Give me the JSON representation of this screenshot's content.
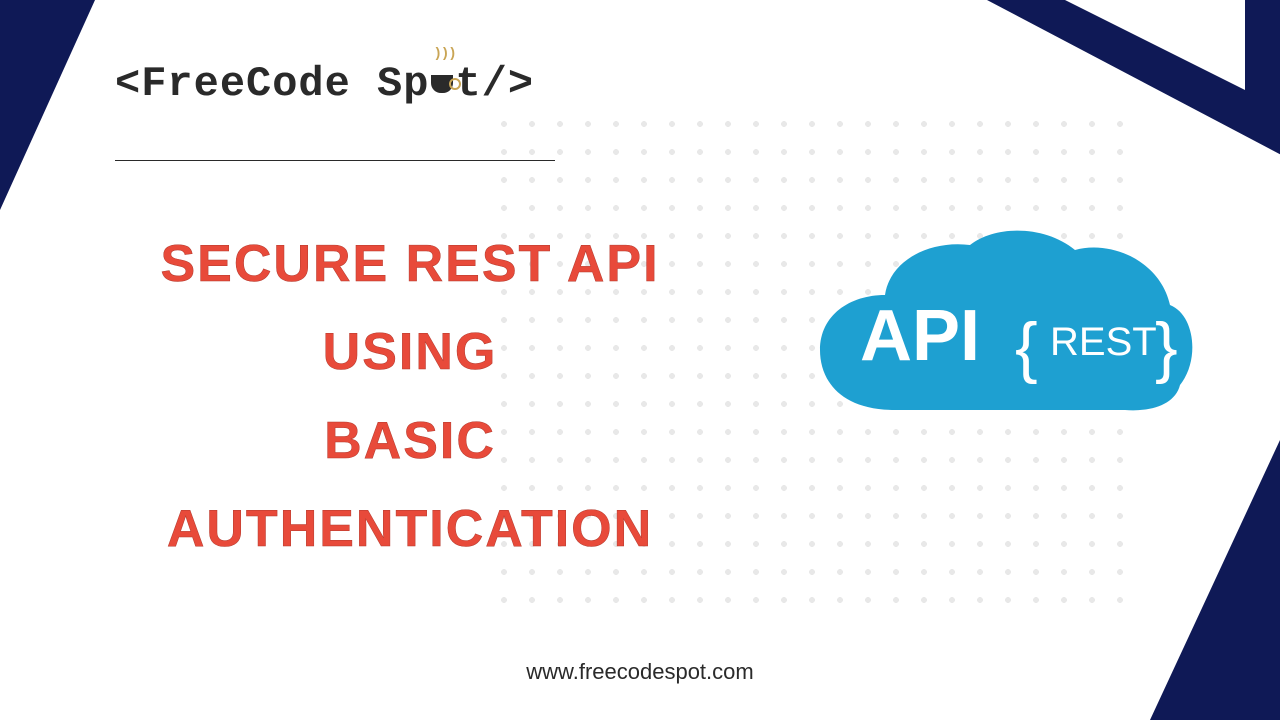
{
  "logo": {
    "prefix": "<FreeCode Sp",
    "suffix": "t/>"
  },
  "headline": {
    "line1": "Secure REST API",
    "line2": "USING",
    "line3": "Basic Authentication"
  },
  "cloud": {
    "api_text": "API",
    "rest_text": "REST"
  },
  "footer": {
    "url": "www.freecodespot.com"
  },
  "colors": {
    "navy": "#0f1956",
    "red": "#e84a3a",
    "cloud_blue": "#1ea0d1"
  }
}
